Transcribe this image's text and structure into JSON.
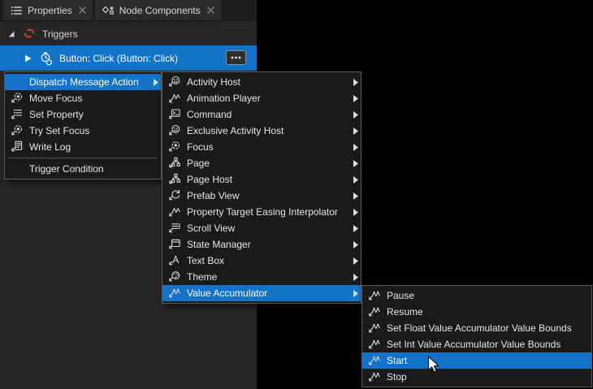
{
  "colors": {
    "accent_blue": "#1273c8",
    "triggers_red": "#da4538",
    "panel_bg": "#262626",
    "menu_bg": "#1a1a1a",
    "menu_border": "#5a5a5a"
  },
  "tabs": [
    {
      "label": "Properties",
      "icon": "properties-list-icon",
      "close_icon": "close-icon"
    },
    {
      "label": "Node Components",
      "icon": "node-components-icon",
      "close_icon": "close-icon"
    }
  ],
  "triggers_panel": {
    "header": "Triggers",
    "header_icon": "triggers-icon",
    "selected_item": "Button: Click (Button: Click)",
    "selected_item_icon": "trigger-clock-icon",
    "more_button_icon": "ellipsis-icon"
  },
  "context_menu": {
    "items": [
      {
        "label": "Dispatch Message Action",
        "submenu": true,
        "highlighted": true
      },
      {
        "label": "Move Focus",
        "icon": "focus"
      },
      {
        "label": "Set Property",
        "icon": "set-property"
      },
      {
        "label": "Try Set Focus",
        "icon": "focus"
      },
      {
        "label": "Write Log",
        "icon": "write-log"
      },
      {
        "separator": true
      },
      {
        "label": "Trigger Condition"
      }
    ]
  },
  "dispatch_submenu": {
    "items": [
      {
        "label": "Activity Host",
        "icon": "activity-host",
        "submenu": true
      },
      {
        "label": "Animation Player",
        "icon": "animation",
        "submenu": true
      },
      {
        "label": "Command",
        "icon": "command",
        "submenu": true
      },
      {
        "label": "Exclusive Activity Host",
        "icon": "activity-host",
        "submenu": true
      },
      {
        "label": "Focus",
        "icon": "focus",
        "submenu": true
      },
      {
        "label": "Page",
        "icon": "page",
        "submenu": true
      },
      {
        "label": "Page Host",
        "icon": "page",
        "submenu": true
      },
      {
        "label": "Prefab View",
        "icon": "prefab-view",
        "submenu": true
      },
      {
        "label": "Property Target Easing Interpolator",
        "icon": "animation",
        "submenu": true
      },
      {
        "label": "Scroll View",
        "icon": "scroll-view",
        "submenu": true
      },
      {
        "label": "State Manager",
        "icon": "state-manager",
        "submenu": true
      },
      {
        "label": "Text Box",
        "icon": "text-box",
        "submenu": true
      },
      {
        "label": "Theme",
        "icon": "theme",
        "submenu": true
      },
      {
        "label": "Value Accumulator",
        "icon": "value-accumulator",
        "submenu": true,
        "highlighted": true
      }
    ]
  },
  "value_accumulator_submenu": {
    "items": [
      {
        "label": "Pause",
        "icon": "value-accumulator"
      },
      {
        "label": "Resume",
        "icon": "value-accumulator"
      },
      {
        "label": "Set Float Value Accumulator Value Bounds",
        "icon": "value-accumulator"
      },
      {
        "label": "Set Int Value Accumulator Value Bounds",
        "icon": "value-accumulator"
      },
      {
        "label": "Start",
        "icon": "value-accumulator",
        "highlighted": true
      },
      {
        "label": "Stop",
        "icon": "value-accumulator"
      }
    ]
  }
}
